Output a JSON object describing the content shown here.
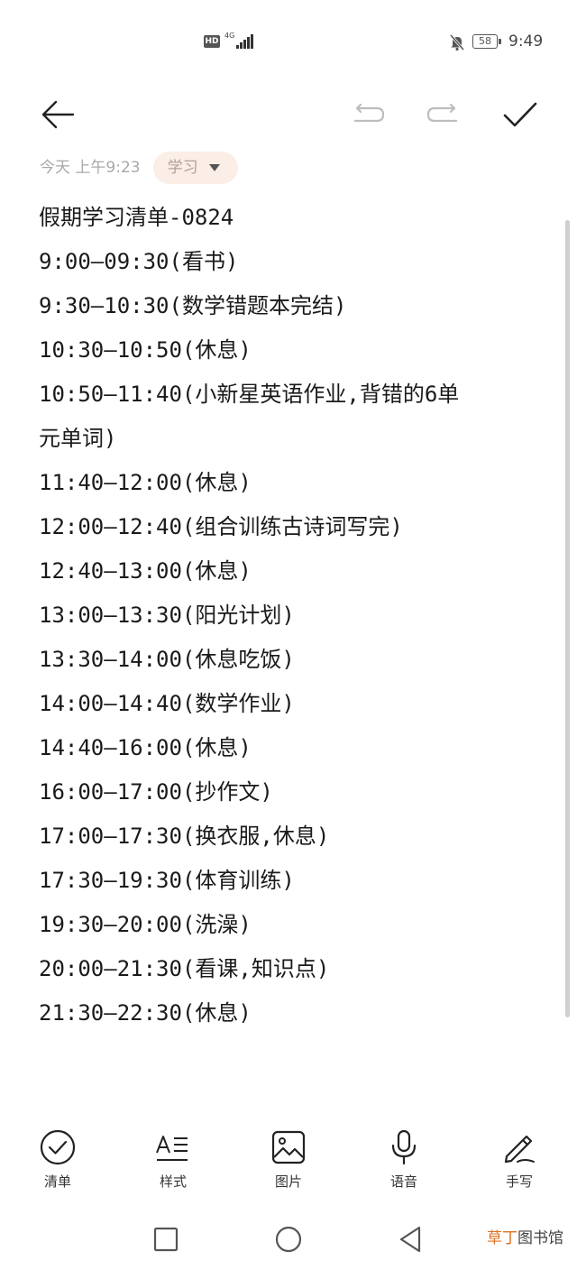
{
  "status_bar": {
    "hd": "HD",
    "network": "4G",
    "battery": "58",
    "time": "9:49"
  },
  "meta": {
    "date": "今天 上午9:23",
    "tag": "学习"
  },
  "note": {
    "lines": [
      "假期学习清单-0824",
      "9:00—09:30(看书)",
      "9:30—10:30(数学错题本完结)",
      "10:30—10:50(休息)",
      "10:50—11:40(小新星英语作业,背错的6单",
      "元单词)",
      "11:40—12:00(休息)",
      "12:00—12:40(组合训练古诗词写完)",
      "12:40—13:00(休息)",
      "13:00—13:30(阳光计划)",
      "13:30—14:00(休息吃饭)",
      "14:00—14:40(数学作业)",
      "14:40—16:00(休息)",
      "16:00—17:00(抄作文)",
      "17:00—17:30(换衣服,休息)",
      "17:30—19:30(体育训练)",
      "19:30—20:00(洗澡)",
      "20:00—21:30(看课,知识点)",
      "21:30—22:30(休息)"
    ]
  },
  "tools": {
    "checklist": "清单",
    "style": "样式",
    "image": "图片",
    "voice": "语音",
    "handwriting": "手写"
  },
  "watermark": {
    "part1": "草丁",
    "part2": "图书馆"
  }
}
